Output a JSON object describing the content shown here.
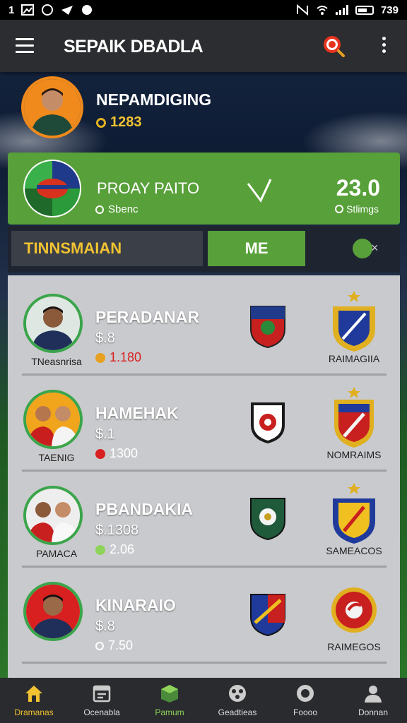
{
  "status_bar": {
    "left_text": "1",
    "right_text": "739"
  },
  "app_bar": {
    "title": "SEPAIK DBADLA"
  },
  "profile": {
    "name": "NEPAMDIGING",
    "coins": "1283"
  },
  "feature_card": {
    "title": "PROAY PAITO",
    "subtitle": "Sbenc",
    "score": "23.0",
    "score_sub": "Stlimgs"
  },
  "tabs": {
    "left_label": "TINNSMAIAN",
    "me_label": "ME"
  },
  "rows": [
    {
      "name": "PERADANAR",
      "price": "$.8",
      "stat": "1.180",
      "caption": "TNeasnrisa",
      "crest_label": "RAIMAGIIA",
      "stat_color": "#e8a020",
      "stat_text_color": "#d82020"
    },
    {
      "name": "HAMEHAK",
      "price": "$.1",
      "stat": "1300",
      "caption": "TAENIG",
      "crest_label": "NOMRAIMS",
      "stat_color": "#d82020",
      "stat_text_color": "#ffffff"
    },
    {
      "name": "PBANDAKIA",
      "price": "$.1308",
      "stat": "2.06",
      "caption": "PAMACA",
      "crest_label": "SAMEACOS",
      "stat_color": "#8fd45a",
      "stat_text_color": "#ffffff"
    },
    {
      "name": "KINARAIO",
      "price": "$.8",
      "stat": "7.50",
      "caption": "",
      "crest_label": "RAIMEGOS",
      "stat_color": "#ffffff",
      "stat_text_color": "#ffffff"
    }
  ],
  "bottom_nav": [
    {
      "label": "Dramanas",
      "icon": "home-icon"
    },
    {
      "label": "Ocenabla",
      "icon": "calendar-icon"
    },
    {
      "label": "Pamum",
      "icon": "box-icon"
    },
    {
      "label": "Geadtieas",
      "icon": "soccer-ball-icon"
    },
    {
      "label": "Foooo",
      "icon": "circle-icon"
    },
    {
      "label": "Donnan",
      "icon": "user-icon"
    }
  ],
  "colors": {
    "accent_green": "#58a03a",
    "accent_yellow": "#f1c232",
    "header": "#2c2d30"
  }
}
